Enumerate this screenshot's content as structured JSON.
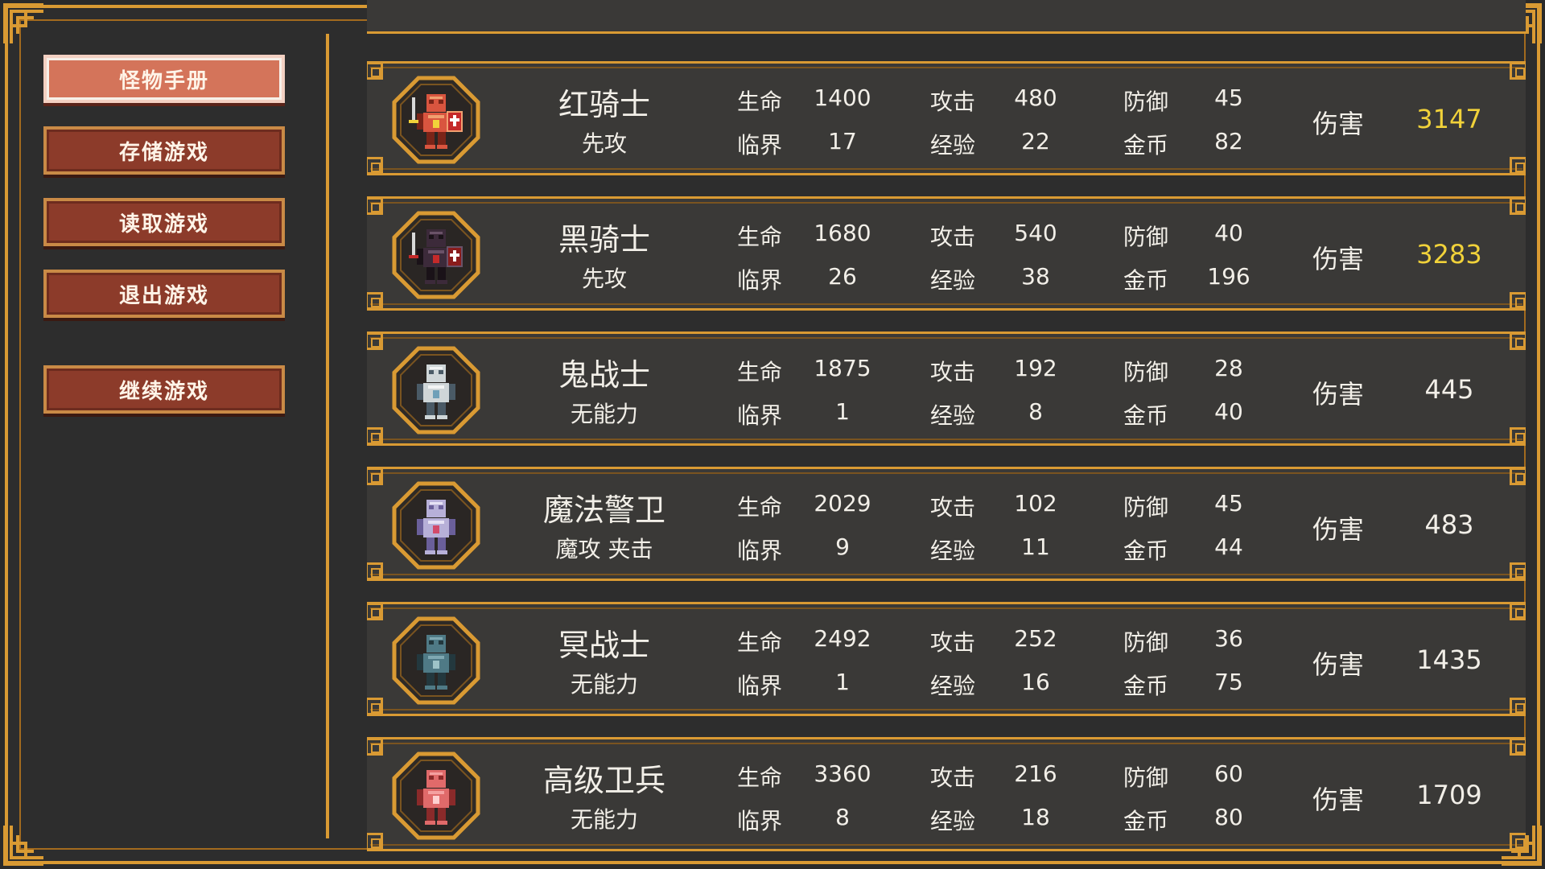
{
  "menu": {
    "items": [
      {
        "label": "怪物手册",
        "active": true
      },
      {
        "label": "存储游戏",
        "active": false
      },
      {
        "label": "读取游戏",
        "active": false
      },
      {
        "label": "退出游戏",
        "active": false
      },
      {
        "label": "继续游戏",
        "active": false
      }
    ]
  },
  "labels": {
    "hp": "生命",
    "atk": "攻击",
    "def": "防御",
    "crit": "临界",
    "exp": "经验",
    "gold": "金币",
    "damage": "伤害"
  },
  "colors": {
    "accent": "#d99a33",
    "high_damage": "#f1d23a",
    "button": "#8c3b2a",
    "button_active": "#d4745a"
  },
  "monsters": [
    {
      "name": "红骑士",
      "ability": "先攻",
      "hp": "1400",
      "atk": "480",
      "def": "45",
      "crit": "17",
      "exp": "22",
      "gold": "82",
      "damage": "3147",
      "damage_high": true,
      "icon": "red-knight-icon"
    },
    {
      "name": "黑骑士",
      "ability": "先攻",
      "hp": "1680",
      "atk": "540",
      "def": "40",
      "crit": "26",
      "exp": "38",
      "gold": "196",
      "damage": "3283",
      "damage_high": true,
      "icon": "black-knight-icon"
    },
    {
      "name": "鬼战士",
      "ability": "无能力",
      "hp": "1875",
      "atk": "192",
      "def": "28",
      "crit": "1",
      "exp": "8",
      "gold": "40",
      "damage": "445",
      "damage_high": false,
      "icon": "ghost-warrior-icon"
    },
    {
      "name": "魔法警卫",
      "ability": "魔攻 夹击",
      "hp": "2029",
      "atk": "102",
      "def": "45",
      "crit": "9",
      "exp": "11",
      "gold": "44",
      "damage": "483",
      "damage_high": false,
      "icon": "magic-guard-icon"
    },
    {
      "name": "冥战士",
      "ability": "无能力",
      "hp": "2492",
      "atk": "252",
      "def": "36",
      "crit": "1",
      "exp": "16",
      "gold": "75",
      "damage": "1435",
      "damage_high": false,
      "icon": "nether-warrior-icon"
    },
    {
      "name": "高级卫兵",
      "ability": "无能力",
      "hp": "3360",
      "atk": "216",
      "def": "60",
      "crit": "8",
      "exp": "18",
      "gold": "80",
      "damage": "1709",
      "damage_high": false,
      "icon": "senior-guard-icon"
    }
  ]
}
